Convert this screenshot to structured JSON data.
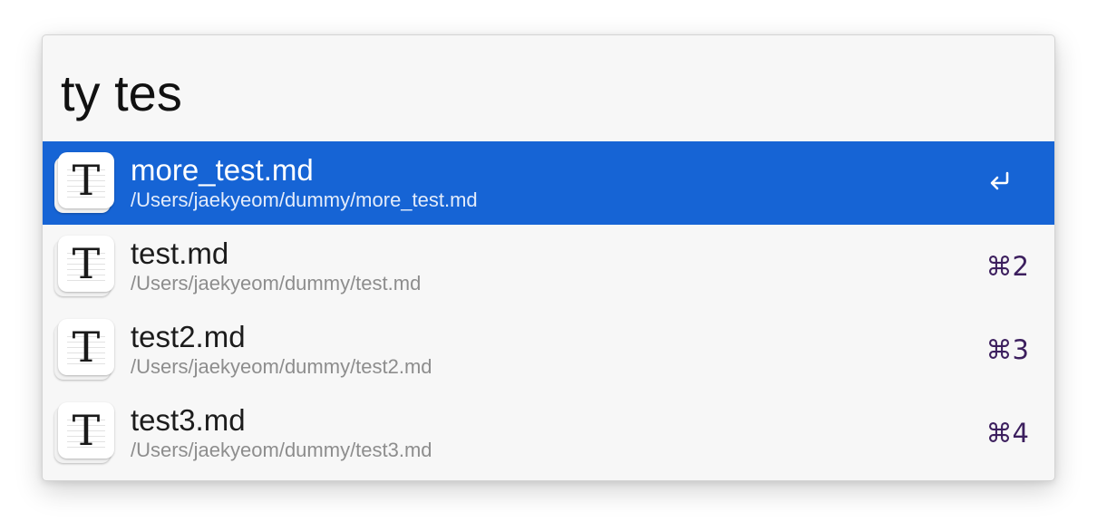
{
  "search": {
    "query": "ty tes"
  },
  "results": [
    {
      "title": "more_test.md",
      "path": "/Users/jaekyeom/dummy/more_test.md",
      "shortcut": "",
      "icon": "text-edit-icon",
      "selected": true
    },
    {
      "title": "test.md",
      "path": "/Users/jaekyeom/dummy/test.md",
      "shortcut": "⌘2",
      "icon": "text-edit-icon",
      "selected": false
    },
    {
      "title": "test2.md",
      "path": "/Users/jaekyeom/dummy/test2.md",
      "shortcut": "⌘3",
      "icon": "text-edit-icon",
      "selected": false
    },
    {
      "title": "test3.md",
      "path": "/Users/jaekyeom/dummy/test3.md",
      "shortcut": "⌘4",
      "icon": "text-edit-icon",
      "selected": false
    }
  ],
  "colors": {
    "selection": "#1664d5",
    "shortcut_text": "#3c1f5e",
    "path_text": "#8d8d8d"
  },
  "icon_letter": "T"
}
